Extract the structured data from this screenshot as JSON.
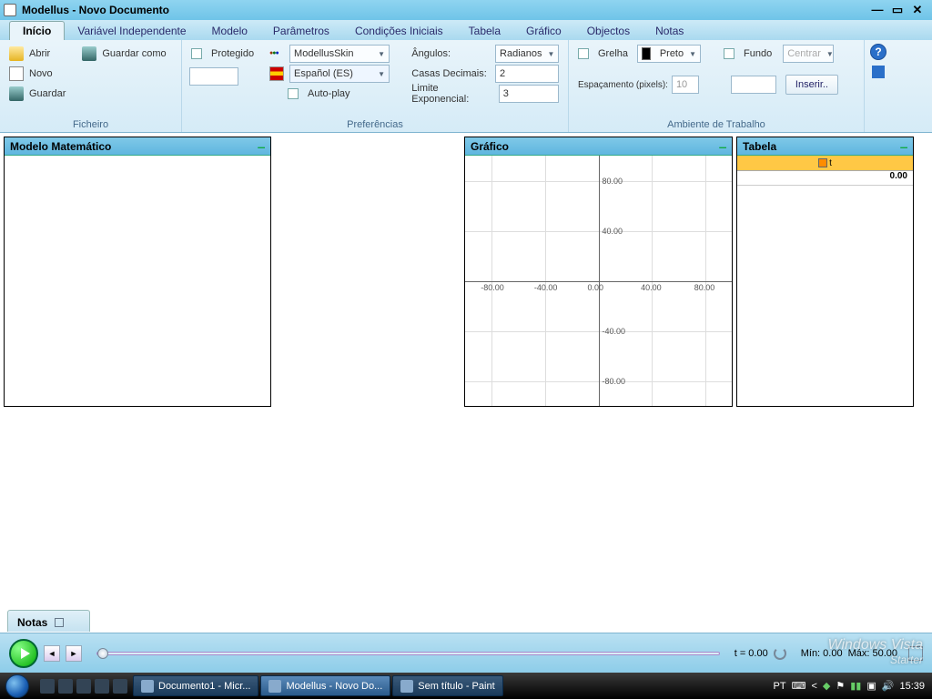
{
  "window": {
    "title": "Modellus - Novo Documento"
  },
  "tabs": [
    "Início",
    "Variável Independente",
    "Modelo",
    "Parâmetros",
    "Condições Iniciais",
    "Tabela",
    "Gráfico",
    "Objectos",
    "Notas"
  ],
  "active_tab": "Início",
  "ficheiro": {
    "label": "Ficheiro",
    "abrir": "Abrir",
    "guardar_como": "Guardar como",
    "novo": "Novo",
    "guardar": "Guardar"
  },
  "prefs": {
    "label": "Preferências",
    "protegido": "Protegido",
    "skin": "ModellusSkin",
    "lang": "Español (ES)",
    "autoplay": "Auto-play",
    "angulos": "Ângulos:",
    "angulos_val": "Radianos",
    "casas": "Casas Decimais:",
    "casas_val": "2",
    "limite": "Limite Exponencial:",
    "limite_val": "3"
  },
  "amb": {
    "label": "Ambiente de Trabalho",
    "grelha": "Grelha",
    "cor": "Preto",
    "esp_lbl": "Espaçamento (pixels):",
    "esp_val": "10",
    "fundo": "Fundo",
    "centrar": "Centrar",
    "inserir": "Inserir.."
  },
  "panels": {
    "math": "Modelo Matemático",
    "graf": "Gráfico",
    "tabela": "Tabela",
    "notas": "Notas"
  },
  "tabela": {
    "value": "0.00"
  },
  "chart_data": {
    "type": "scatter",
    "series": [],
    "xlim": [
      -100,
      100
    ],
    "ylim": [
      -100,
      100
    ],
    "xticks": [
      -80,
      -40,
      0,
      40,
      80
    ],
    "yticks": [
      -80,
      -40,
      0,
      40,
      80
    ],
    "xticklabels": [
      "-80.00",
      "-40.00",
      "0.00",
      "40.00",
      "80.00"
    ],
    "yticklabels": [
      "-80.00",
      "-40.00",
      "",
      "40.00",
      "80.00"
    ]
  },
  "player": {
    "t_lbl": "t  = 0.00",
    "min": "Mín: 0.00",
    "max": "Máx: 50.00"
  },
  "watermark": {
    "main": "Windows Vista",
    "sub": "Starter"
  },
  "taskbar": {
    "items": [
      {
        "label": "Documento1 - Micr...",
        "active": false
      },
      {
        "label": "Modellus - Novo Do...",
        "active": true
      },
      {
        "label": "Sem título - Paint",
        "active": false
      }
    ],
    "lang": "PT",
    "clock": "15:39"
  }
}
